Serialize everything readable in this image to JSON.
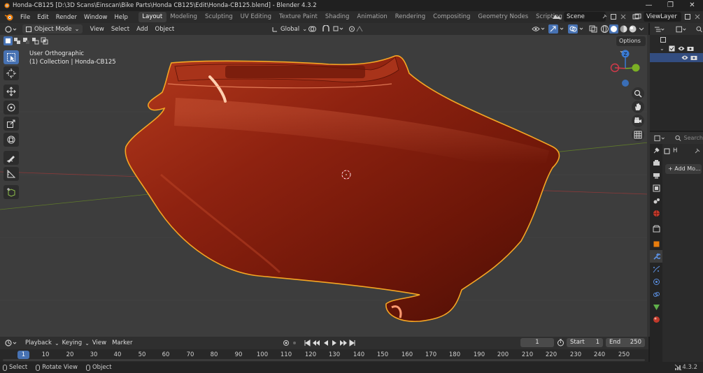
{
  "window": {
    "title": "Honda-CB125 [D:\\3D Scans\\Einscan\\Bike Parts\\Honda CB125\\Edit\\Honda-CB125.blend] - Blender 4.3.2",
    "minimize": "—",
    "maximize": "❐",
    "close": "✕"
  },
  "menus": [
    "File",
    "Edit",
    "Render",
    "Window",
    "Help"
  ],
  "workspaces": [
    "Layout",
    "Modeling",
    "Sculpting",
    "UV Editing",
    "Texture Paint",
    "Shading",
    "Animation",
    "Rendering",
    "Compositing",
    "Geometry Nodes",
    "Scripting"
  ],
  "workspace_add": "+",
  "scene": {
    "name": "Scene"
  },
  "view_layer": {
    "name": "ViewLayer"
  },
  "viewport_header": {
    "mode": "Object Mode",
    "menus": [
      "View",
      "Select",
      "Add",
      "Object"
    ],
    "orientation": "Global"
  },
  "viewport": {
    "view_name": "User Orthographic",
    "collection_info": "(1) Collection | Honda-CB125",
    "options_label": "Options",
    "gizmo": {
      "x": "X",
      "y": "Y",
      "z": "Z"
    }
  },
  "properties": {
    "search_placeholder": "Search",
    "object_name": "H",
    "add_modifier": "Add Mo..."
  },
  "timeline": {
    "menus": [
      "Playback",
      "Keying",
      "View",
      "Marker"
    ],
    "current_frame": "1",
    "start_label": "Start",
    "start_value": "1",
    "end_label": "End",
    "end_value": "250",
    "ruler": [
      "10",
      "20",
      "30",
      "40",
      "50",
      "60",
      "70",
      "80",
      "90",
      "100",
      "110",
      "120",
      "130",
      "140",
      "150",
      "160",
      "170",
      "180",
      "190",
      "200",
      "210",
      "220",
      "230",
      "240",
      "250"
    ],
    "ruler_current": "1"
  },
  "statusbar": {
    "select": "Select",
    "rotate": "Rotate View",
    "object": "Object",
    "version": "4.3.2"
  },
  "colors": {
    "accent": "#4772b3",
    "selection_outline": "#f5a623",
    "model": "#8e2210",
    "axis_x": "#d23a4a",
    "axis_y": "#7bb024",
    "axis_z": "#3a7bd5"
  }
}
